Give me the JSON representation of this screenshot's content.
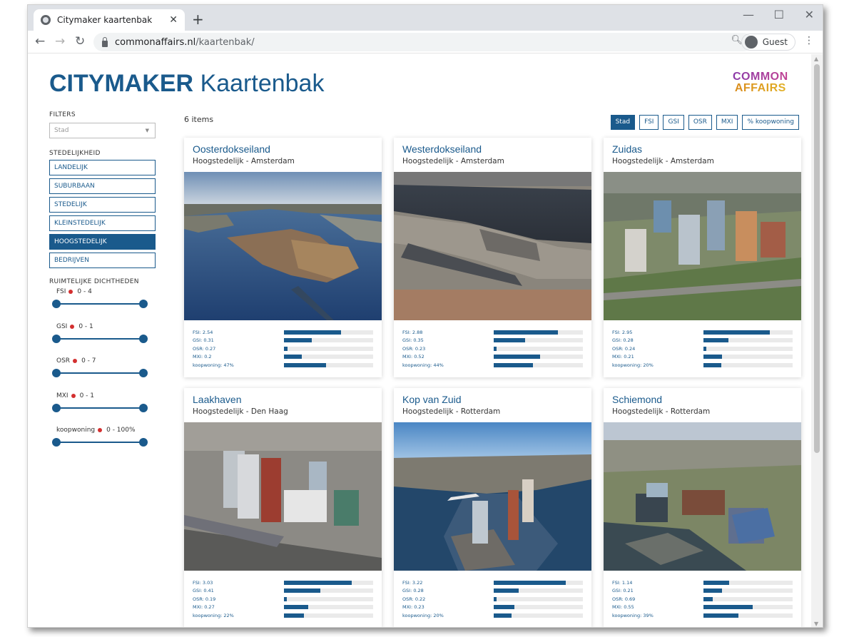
{
  "browser": {
    "tab_title": "Citymaker kaartenbak",
    "url_host": "commonaffairs.nl",
    "url_path": "/kaartenbak/",
    "profile": "Guest"
  },
  "header": {
    "brand_bold": "CITYMAKER",
    "brand_light": "Kaartenbak",
    "logo_line1": "COMMON",
    "logo_line2": "AFFAIRS"
  },
  "sidebar": {
    "filters_label": "FILTERS",
    "select_placeholder": "Stad",
    "stedelijkheid_label": "STEDELIJKHEID",
    "options": [
      {
        "label": "LANDELIJK",
        "active": false
      },
      {
        "label": "SUBURBAAN",
        "active": false
      },
      {
        "label": "STEDELIJK",
        "active": false
      },
      {
        "label": "KLEINSTEDELIJK",
        "active": false
      },
      {
        "label": "HOOGSTEDELIJK",
        "active": true
      },
      {
        "label": "BEDRIJVEN",
        "active": false
      }
    ],
    "ruimte_label": "RUIMTELIJKE DICHTHEDEN",
    "ranges": [
      {
        "name": "FSI",
        "range": "0 - 4"
      },
      {
        "name": "GSI",
        "range": "0 - 1"
      },
      {
        "name": "OSR",
        "range": "0 - 7"
      },
      {
        "name": "MXI",
        "range": "0 - 1"
      },
      {
        "name": "koopwoning",
        "range": "0 - 100%"
      }
    ]
  },
  "main": {
    "count": "6 items",
    "sort_buttons": [
      {
        "label": "Stad",
        "active": true
      },
      {
        "label": "FSI",
        "active": false
      },
      {
        "label": "GSI",
        "active": false
      },
      {
        "label": "OSR",
        "active": false
      },
      {
        "label": "MXI",
        "active": false
      },
      {
        "label": "% koopwoning",
        "active": false
      }
    ],
    "cards": [
      {
        "title": "Oosterdokseiland",
        "subtitle": "Hoogstedelijk - Amsterdam",
        "stats": [
          {
            "label": "FSI: 2.54",
            "fill": 0.64
          },
          {
            "label": "GSI: 0.31",
            "fill": 0.31
          },
          {
            "label": "OSR: 0.27",
            "fill": 0.04
          },
          {
            "label": "MXI: 0.2",
            "fill": 0.2
          },
          {
            "label": "koopwoning: 47%",
            "fill": 0.47
          }
        ]
      },
      {
        "title": "Westerdokseiland",
        "subtitle": "Hoogstedelijk - Amsterdam",
        "stats": [
          {
            "label": "FSI: 2.88",
            "fill": 0.72
          },
          {
            "label": "GSI: 0.35",
            "fill": 0.35
          },
          {
            "label": "OSR: 0.23",
            "fill": 0.03
          },
          {
            "label": "MXI: 0.52",
            "fill": 0.52
          },
          {
            "label": "koopwoning: 44%",
            "fill": 0.44
          }
        ]
      },
      {
        "title": "Zuidas",
        "subtitle": "Hoogstedelijk - Amsterdam",
        "stats": [
          {
            "label": "FSI: 2.95",
            "fill": 0.74
          },
          {
            "label": "GSI: 0.28",
            "fill": 0.28
          },
          {
            "label": "OSR: 0.24",
            "fill": 0.03
          },
          {
            "label": "MXI: 0.21",
            "fill": 0.21
          },
          {
            "label": "koopwoning: 20%",
            "fill": 0.2
          }
        ]
      },
      {
        "title": "Laakhaven",
        "subtitle": "Hoogstedelijk - Den Haag",
        "stats": [
          {
            "label": "FSI: 3.03",
            "fill": 0.76
          },
          {
            "label": "GSI: 0.41",
            "fill": 0.41
          },
          {
            "label": "OSR: 0.19",
            "fill": 0.03
          },
          {
            "label": "MXI: 0.27",
            "fill": 0.27
          },
          {
            "label": "koopwoning: 22%",
            "fill": 0.22
          }
        ]
      },
      {
        "title": "Kop van Zuid",
        "subtitle": "Hoogstedelijk - Rotterdam",
        "stats": [
          {
            "label": "FSI: 3.22",
            "fill": 0.81
          },
          {
            "label": "GSI: 0.28",
            "fill": 0.28
          },
          {
            "label": "OSR: 0.22",
            "fill": 0.03
          },
          {
            "label": "MXI: 0.23",
            "fill": 0.23
          },
          {
            "label": "koopwoning: 20%",
            "fill": 0.2
          }
        ]
      },
      {
        "title": "Schiemond",
        "subtitle": "Hoogstedelijk - Rotterdam",
        "stats": [
          {
            "label": "FSI: 1.14",
            "fill": 0.29
          },
          {
            "label": "GSI: 0.21",
            "fill": 0.21
          },
          {
            "label": "OSR: 0.69",
            "fill": 0.1
          },
          {
            "label": "MXI: 0.55",
            "fill": 0.55
          },
          {
            "label": "koopwoning: 39%",
            "fill": 0.39
          }
        ]
      }
    ]
  }
}
